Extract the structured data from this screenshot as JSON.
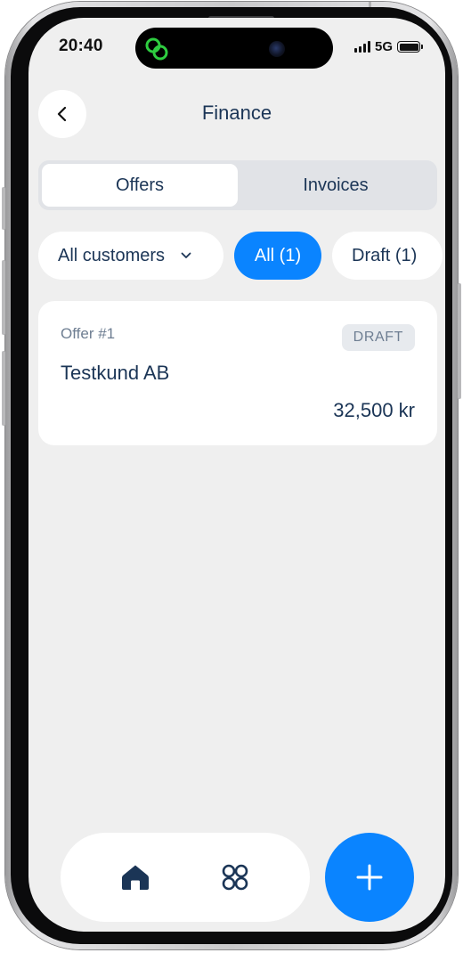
{
  "status_bar": {
    "time": "20:40",
    "network": "5G",
    "battery_level": 1.0,
    "app_icon": "linked-rings-icon",
    "app_icon_color": "#2ecc40"
  },
  "header": {
    "back_icon": "chevron-left-icon",
    "title": "Finance"
  },
  "tabs": [
    {
      "label": "Offers",
      "active": true
    },
    {
      "label": "Invoices",
      "active": false
    }
  ],
  "filters": {
    "customer_select": {
      "value": "All customers",
      "icon": "chevron-down-icon"
    },
    "status_chips": [
      {
        "label": "All (1)",
        "selected": true
      },
      {
        "label": "Draft (1)",
        "selected": false
      }
    ]
  },
  "offers": [
    {
      "number": "Offer #1",
      "status": "DRAFT",
      "customer": "Testkund AB",
      "amount": "32,500 kr"
    }
  ],
  "bottom_nav": {
    "items": [
      {
        "icon": "home-icon"
      },
      {
        "icon": "apps-grid-icon"
      }
    ],
    "fab_icon": "plus-icon",
    "fab_glyph": "+"
  },
  "colors": {
    "accent": "#0a84ff",
    "text_primary": "#1b3556",
    "text_secondary": "#6e7e92",
    "background": "#efefef",
    "surface": "#ffffff"
  }
}
